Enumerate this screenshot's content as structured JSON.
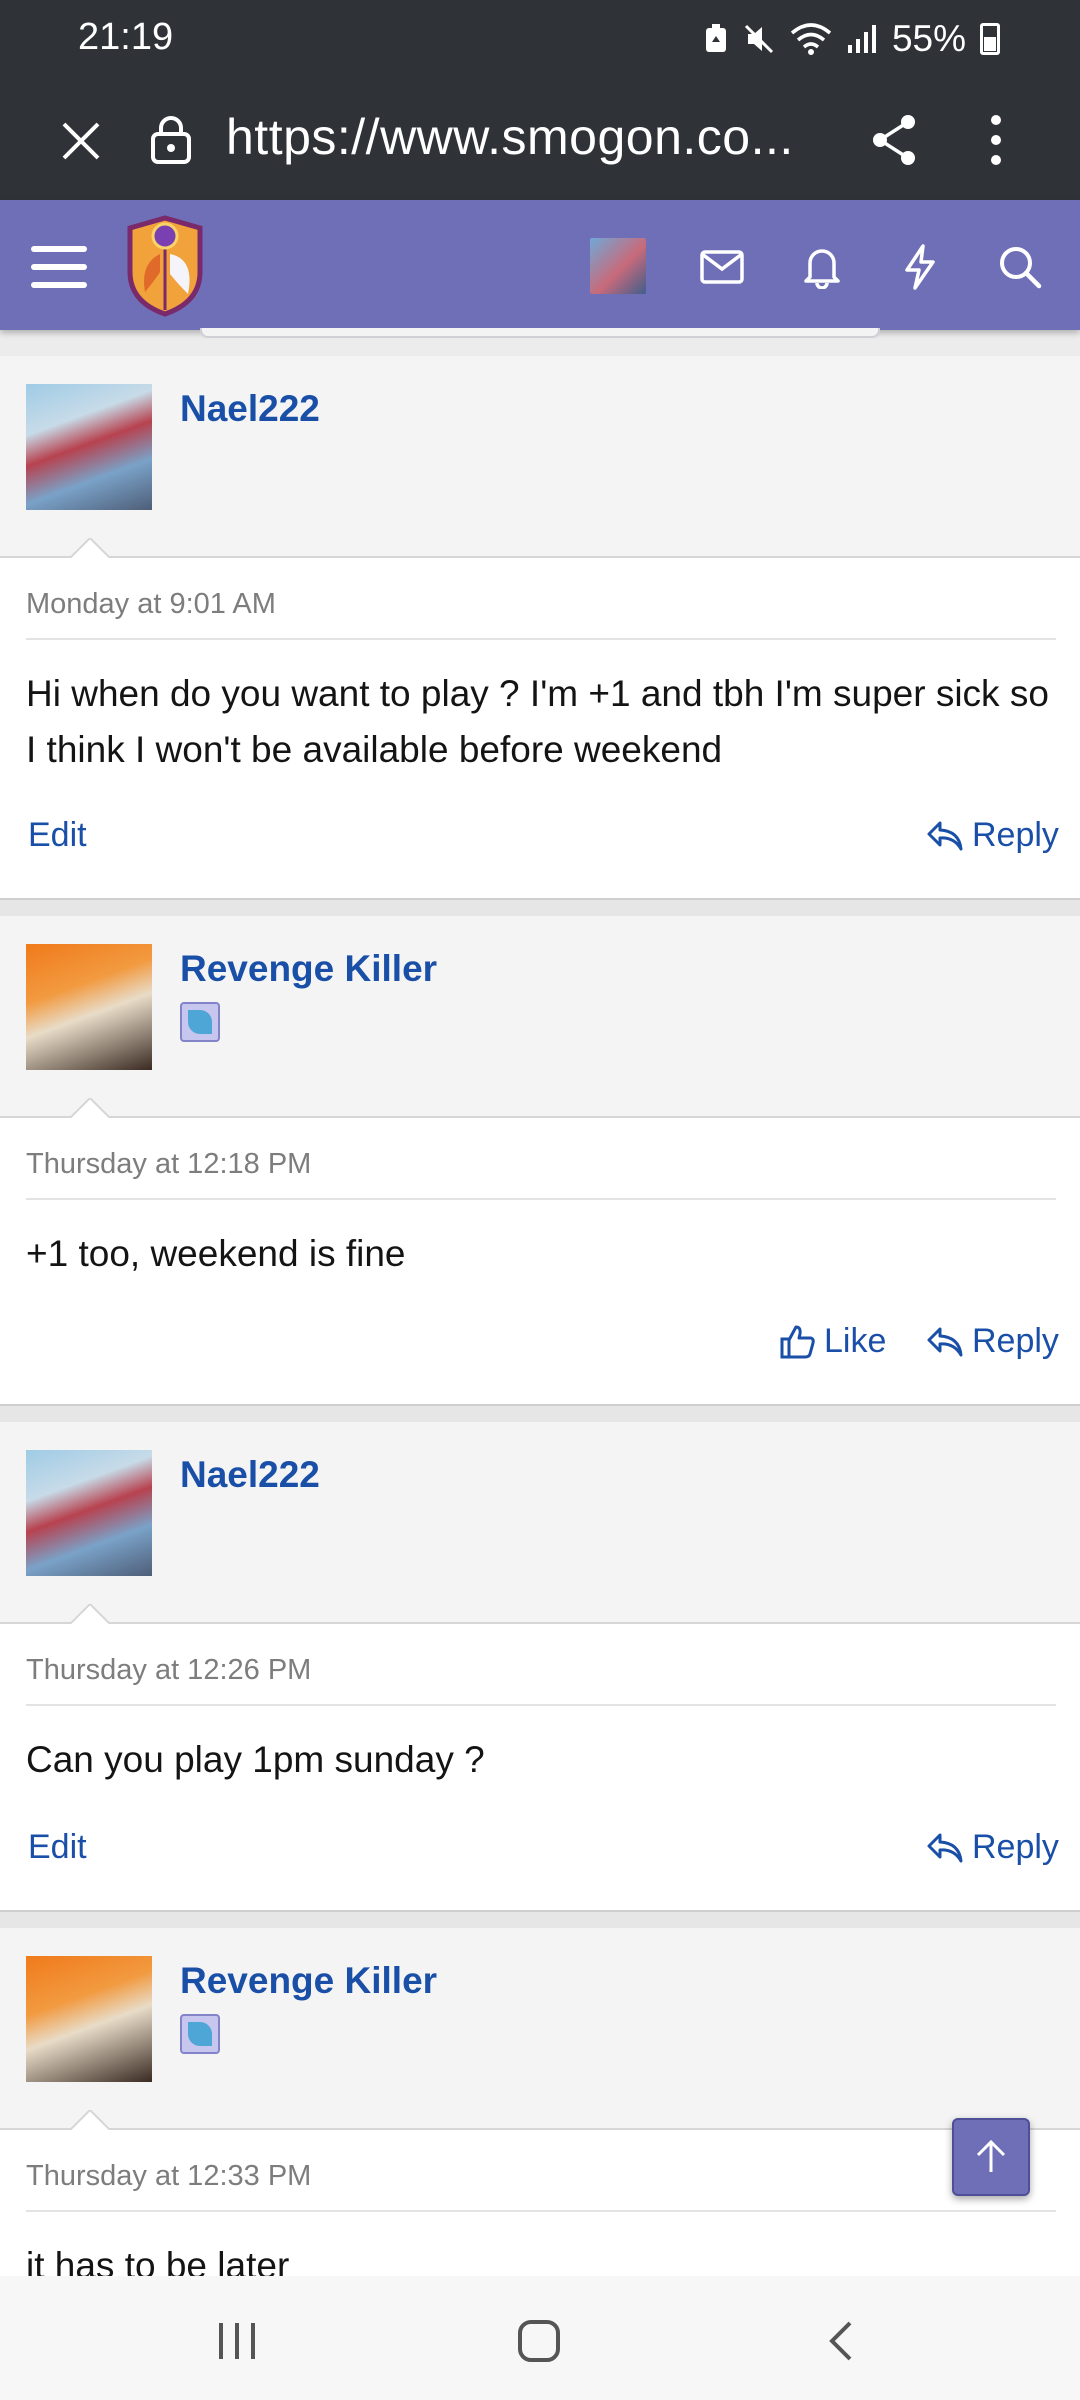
{
  "status_bar": {
    "time": "21:19",
    "battery": "55%",
    "icons": [
      "battery-saver-icon",
      "mute-icon",
      "wifi-icon",
      "signal-icon",
      "battery-icon"
    ]
  },
  "browser": {
    "url": "https://www.smogon.co...",
    "close_icon": "close-icon",
    "lock_icon": "lock-icon",
    "share_icon": "share-icon",
    "menu_icon": "more-vert-icon"
  },
  "site_nav": {
    "menu_icon": "hamburger-icon",
    "logo": "smogon-logo",
    "icons": [
      "user-avatar",
      "mail-icon",
      "bell-icon",
      "lightning-icon",
      "search-icon"
    ],
    "accent": "#6f6fb8"
  },
  "posts": [
    {
      "author": "Nael222",
      "badge": false,
      "time": "Monday at 9:01 AM",
      "message": "Hi when do you want to play ? I'm +1 and tbh I'm super sick so I think I won't be available before weekend",
      "actions": {
        "edit": "Edit",
        "reply": "Reply"
      }
    },
    {
      "author": "Revenge Killer",
      "badge": true,
      "time": "Thursday at 12:18 PM",
      "message": "+1 too, weekend is fine",
      "actions": {
        "like": "Like",
        "reply": "Reply"
      }
    },
    {
      "author": "Nael222",
      "badge": false,
      "time": "Thursday at 12:26 PM",
      "message": "Can you play 1pm sunday ?",
      "actions": {
        "edit": "Edit",
        "reply": "Reply"
      }
    },
    {
      "author": "Revenge Killer",
      "badge": true,
      "time": "Thursday at 12:33 PM",
      "message": "it has to be later"
    }
  ],
  "scroll_top_icon": "arrow-up-icon",
  "android_nav": {
    "icons": [
      "recents-icon",
      "home-icon",
      "back-icon"
    ]
  }
}
